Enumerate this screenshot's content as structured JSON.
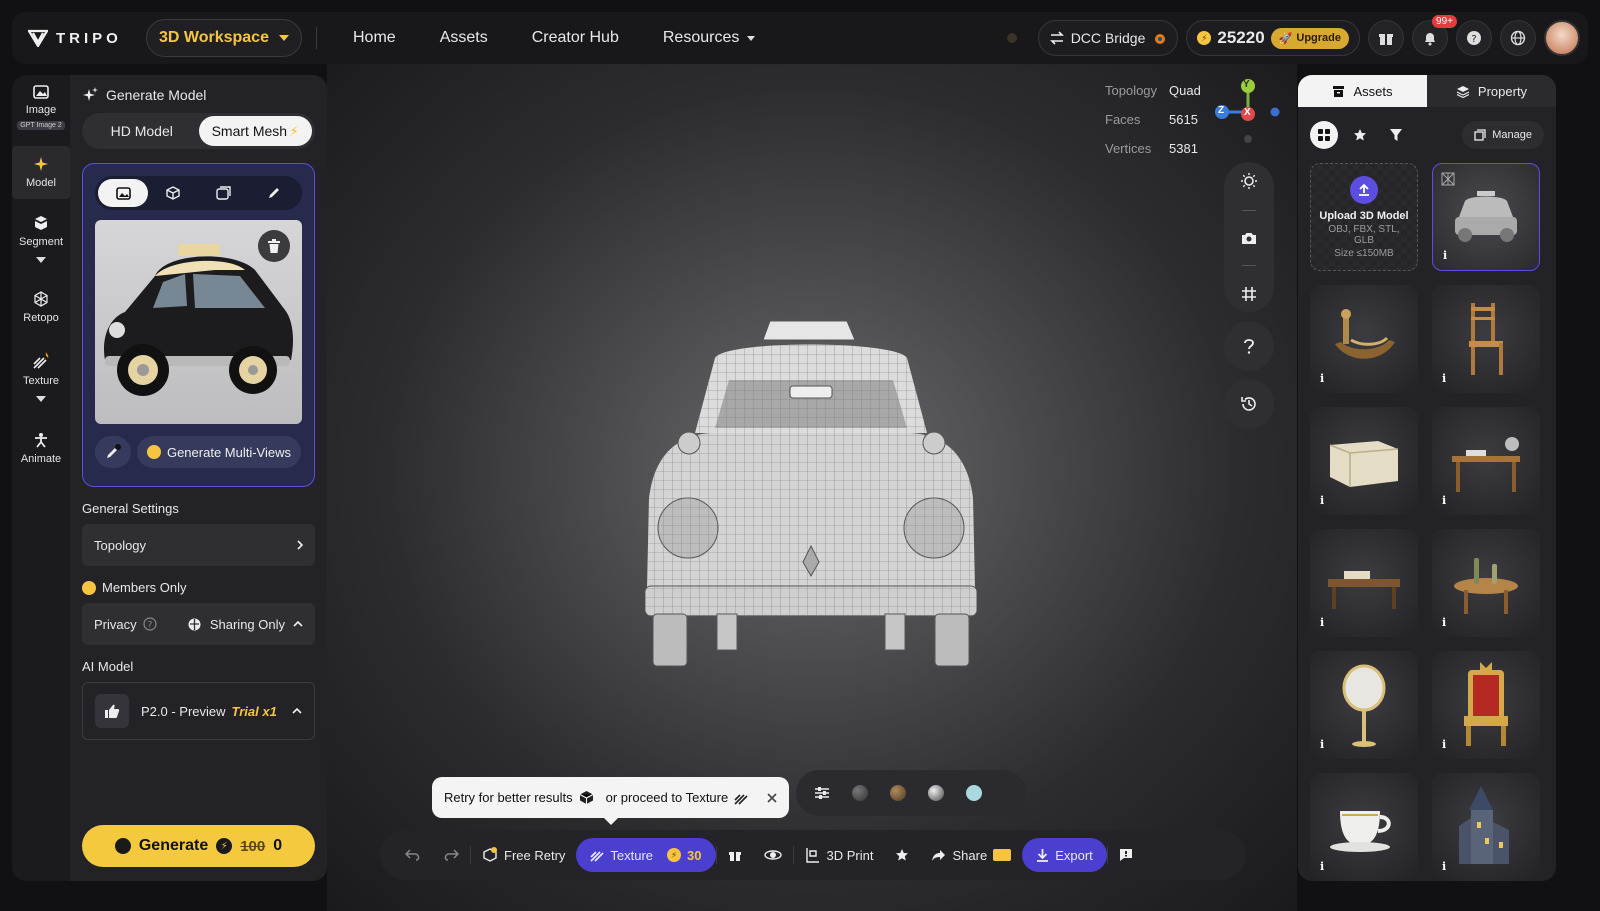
{
  "brand": {
    "name": "TRIPO"
  },
  "header": {
    "workspace": "3D Workspace",
    "nav": [
      "Home",
      "Assets",
      "Creator Hub",
      "Resources"
    ],
    "dcc_bridge": "DCC Bridge",
    "credits": "25220",
    "upgrade": "Upgrade",
    "notifications_badge": "99+"
  },
  "toolrail": {
    "image": {
      "label": "Image",
      "sub": "GPT Image 2"
    },
    "model": "Model",
    "segment": "Segment",
    "retopo": "Retopo",
    "texture": "Texture",
    "animate": "Animate"
  },
  "panel": {
    "title": "Generate Model",
    "modes": [
      "HD Model",
      "Smart Mesh"
    ],
    "generate_multiviews": "Generate Multi-Views",
    "general_settings": "General Settings",
    "topology": "Topology",
    "members_only": "Members Only",
    "privacy_label": "Privacy",
    "privacy_value": "Sharing Only",
    "ai_model_label": "AI Model",
    "ai_model_value": "P2.0 - Preview",
    "ai_model_trial": "Trial x1",
    "generate": "Generate",
    "cost_old": "100",
    "cost_new": "0"
  },
  "viewport": {
    "topology_label": "Topology",
    "topology_value": "Quad",
    "faces_label": "Faces",
    "faces_value": "5615",
    "vertices_label": "Vertices",
    "vertices_value": "5381",
    "axes": {
      "y": "Y",
      "z": "Z",
      "x": "X"
    },
    "tooltip_retry": "Retry for better results",
    "tooltip_proceed": "or proceed to Texture"
  },
  "bottombar": {
    "free_retry": "Free Retry",
    "texture": "Texture",
    "texture_cost": "30",
    "print": "3D Print",
    "share": "Share",
    "export": "Export"
  },
  "rpanel": {
    "tabs": [
      "Assets",
      "Property"
    ],
    "manage": "Manage",
    "upload_title": "Upload 3D Model",
    "upload_formats": "OBJ, FBX, STL, GLB",
    "upload_size": "Size ≤150MB",
    "info_mark": "i"
  },
  "colors": {
    "accent": "#5b4ee0",
    "gold": "#f5c93e",
    "bg": "#111113"
  }
}
